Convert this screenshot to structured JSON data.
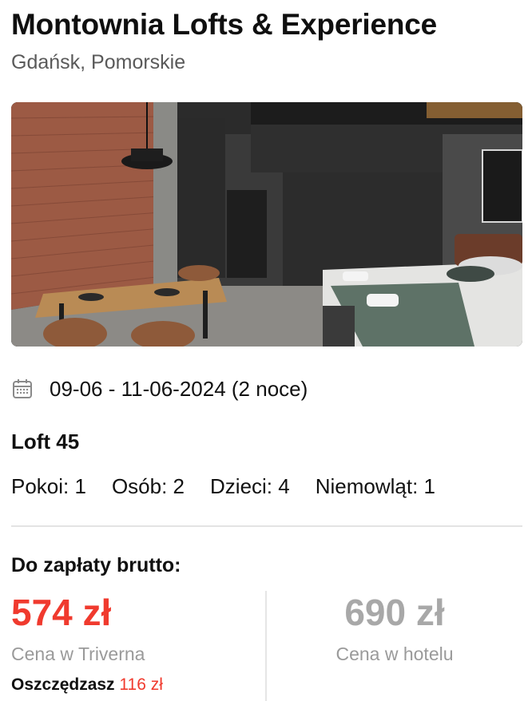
{
  "hotel": {
    "name": "Montownia Lofts & Experience",
    "location": "Gdańsk, Pomorskie"
  },
  "stay": {
    "dates": "09-06 - 11-06-2024 (2 noce)",
    "icon": "calendar-icon"
  },
  "room": {
    "name": "Loft 45"
  },
  "occupancy": [
    {
      "label": "Pokoi: 1"
    },
    {
      "label": "Osób: 2"
    },
    {
      "label": "Dzieci: 4"
    },
    {
      "label": "Niemowląt: 1"
    }
  ],
  "payment": {
    "label": "Do zapłaty brutto:",
    "triverna_price": "574 zł",
    "triverna_label": "Cena w Triverna",
    "savings_prefix": "Oszczędzasz",
    "savings_amount": "116 zł",
    "hotel_price": "690 zł",
    "hotel_label": "Cena w hotelu"
  },
  "colors": {
    "accent_red": "#f03a2e",
    "muted_gray": "#9a9a9a"
  }
}
